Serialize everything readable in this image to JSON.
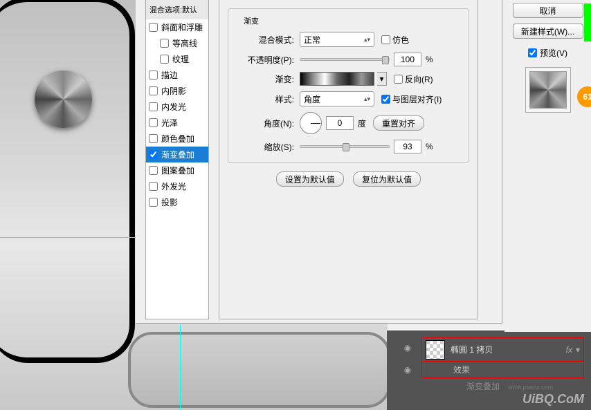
{
  "canvas": {
    "layer_name": "椭圆 1 拷贝",
    "fx_label": "fx",
    "effects_label": "效果",
    "effect_item": "渐变叠加"
  },
  "watermark": {
    "main": "UiBQ.CoM",
    "sub": "www.psanz.com"
  },
  "sidebar": {
    "blend_options": "混合选项:默认",
    "items": [
      "斜面和浮雕",
      "等高线",
      "纹理",
      "描边",
      "内阴影",
      "内发光",
      "光泽",
      "颜色叠加",
      "渐变叠加",
      "图案叠加",
      "外发光",
      "投影"
    ]
  },
  "panel": {
    "title": "渐变",
    "blend_mode_label": "混合模式:",
    "blend_mode_value": "正常",
    "dither_label": "仿色",
    "opacity_label": "不透明度(P):",
    "opacity_value": "100",
    "percent": "%",
    "gradient_label": "渐变:",
    "reverse_label": "反向(R)",
    "style_label": "样式:",
    "style_value": "角度",
    "align_label": "与图层对齐(I)",
    "angle_label": "角度(N):",
    "angle_value": "0",
    "degree": "度",
    "reset_align": "重置对齐",
    "scale_label": "缩放(S):",
    "scale_value": "93",
    "set_default": "设置为默认值",
    "reset_default": "复位为默认值"
  },
  "buttons": {
    "cancel": "取消",
    "new_style": "新建样式(W)...",
    "preview": "预览(V)"
  },
  "badge": "61"
}
